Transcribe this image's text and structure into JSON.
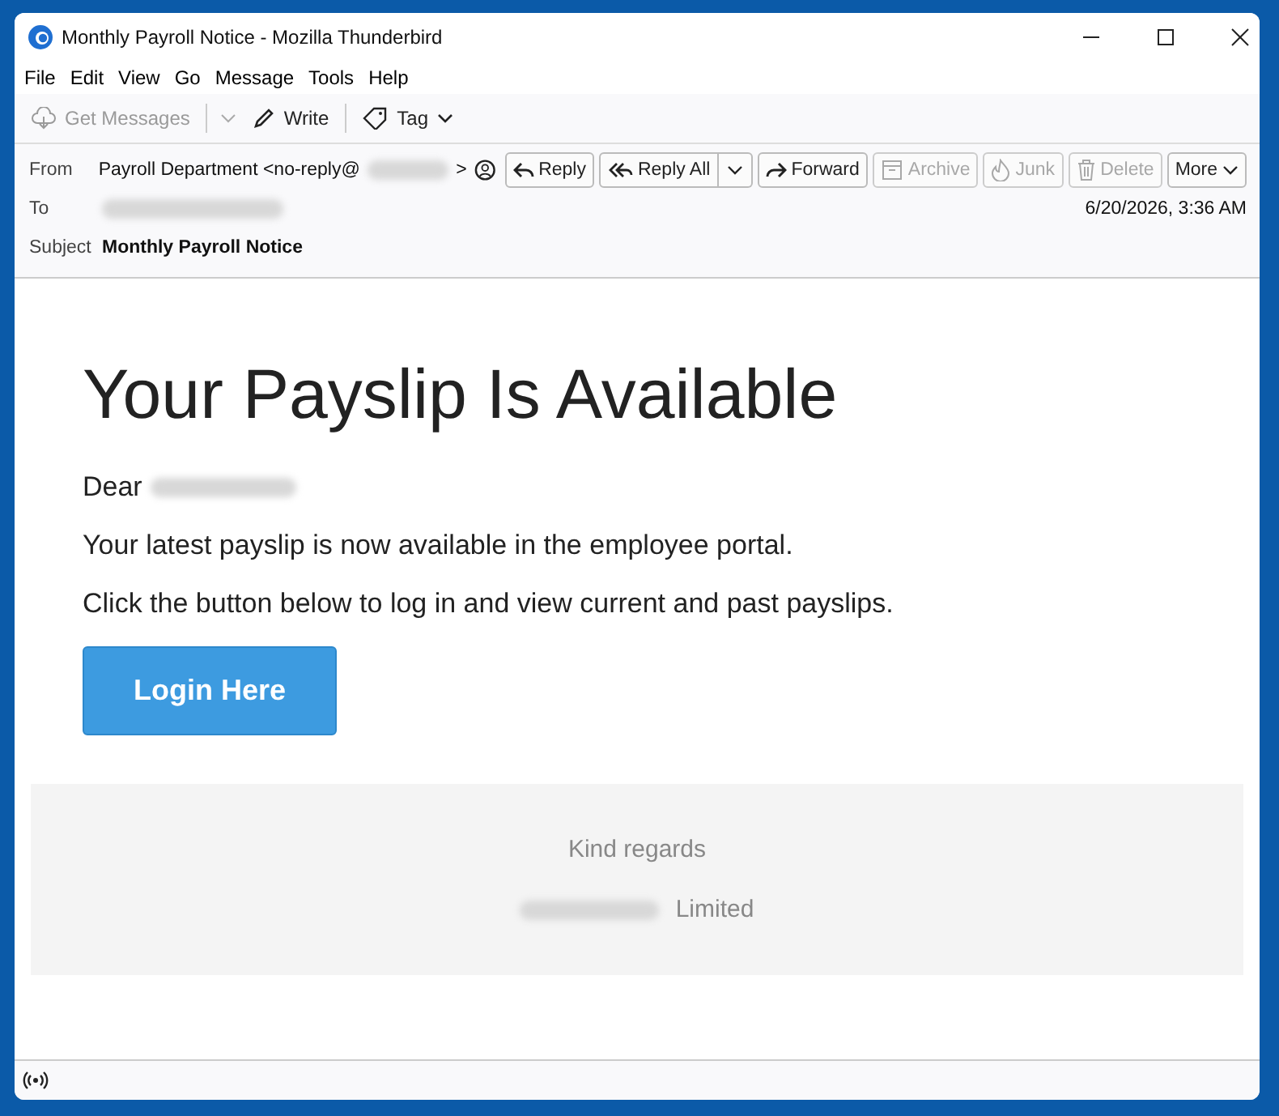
{
  "window": {
    "title": "Monthly Payroll Notice - Mozilla Thunderbird"
  },
  "menu": [
    "File",
    "Edit",
    "View",
    "Go",
    "Message",
    "Tools",
    "Help"
  ],
  "toolbar": [
    {
      "kind": "get",
      "label": "Get Messages",
      "disabled": true
    },
    {
      "kind": "write",
      "label": "Write",
      "disabled": false
    },
    {
      "kind": "tag",
      "label": "Tag",
      "disabled": false
    }
  ],
  "header": {
    "from_label": "From",
    "from": "Payroll Department <no-reply@",
    "from_end": ">",
    "to_label": "To",
    "subject_label": "Subject",
    "subject": "Monthly Payroll Notice",
    "date": "6/20/2026, 3:36 AM",
    "actions": [
      {
        "kind": "reply",
        "label": "Reply",
        "disabled": false
      },
      {
        "kind": "replyall",
        "label": "Reply All",
        "disabled": false
      },
      {
        "kind": "forward",
        "label": "Forward",
        "disabled": false
      },
      {
        "kind": "archive",
        "label": "Archive",
        "disabled": true
      },
      {
        "kind": "junk",
        "label": "Junk",
        "disabled": true
      },
      {
        "kind": "delete",
        "label": "Delete",
        "disabled": true
      },
      {
        "kind": "more",
        "label": "More",
        "disabled": false
      }
    ]
  },
  "email": {
    "heading": "Your Payslip Is Available",
    "greeting": "Dear",
    "paragraphs": [
      "Your latest payslip is now available in the employee portal.",
      "Click the button below to log in and view current and past payslips."
    ],
    "button": "Login Here",
    "closing": "Kind regards",
    "company_suffix": "Limited"
  }
}
